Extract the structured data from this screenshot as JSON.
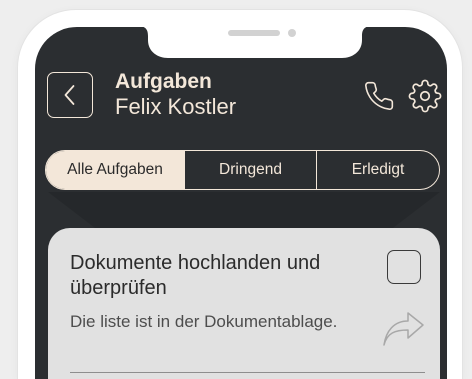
{
  "header": {
    "title": "Aufgaben",
    "subtitle": "Felix Kostler",
    "back_icon": "chevron-left-icon",
    "call_icon": "phone-icon",
    "settings_icon": "gear-icon"
  },
  "tabs": [
    {
      "label": "Alle Aufgaben",
      "selected": true
    },
    {
      "label": "Dringend",
      "selected": false
    },
    {
      "label": "Erledigt",
      "selected": false
    }
  ],
  "tasks": [
    {
      "title": "Dokumente hochlanden und überprüfen",
      "description": "Die liste ist in der Dokumentablage.",
      "completed": false,
      "action_icon": "forward-arrow-icon"
    }
  ],
  "colors": {
    "screen_background": "#2b2e31",
    "accent_cream": "#f3e7d9",
    "card_background": "#e1e1e1",
    "text_dark": "#2b2b2b"
  }
}
